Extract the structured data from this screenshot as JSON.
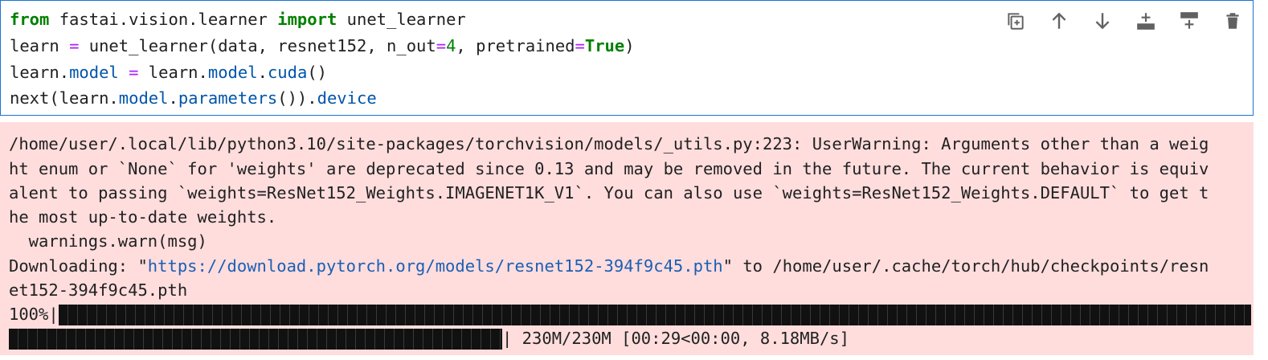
{
  "code": {
    "line1": {
      "kw_from": "from",
      "module": " fastai.vision.learner ",
      "kw_import": "import",
      "name": " unet_learner"
    },
    "line2": {
      "a": "learn ",
      "eq": "=",
      "b": " unet_learner(data, resnet152, n_out",
      "eq2": "=",
      "num": "4",
      "c": ", pretrained",
      "eq3": "=",
      "true": "True",
      "d": ")"
    },
    "line3": {
      "a": "learn.",
      "attr1": "model",
      "b": " ",
      "eq": "=",
      "c": " learn.",
      "attr2": "model",
      "d": ".",
      "attr3": "cuda",
      "e": "()"
    },
    "line4": {
      "a": "next(learn.",
      "attr1": "model",
      "b": ".",
      "attr2": "parameters",
      "c": "()).",
      "attr3": "device"
    }
  },
  "toolbar": {
    "icons": [
      "duplicate-icon",
      "move-up-icon",
      "move-down-icon",
      "insert-below-icon",
      "insert-above-icon",
      "delete-icon"
    ]
  },
  "output": {
    "warn1": "/home/user/.local/lib/python3.10/site-packages/torchvision/models/_utils.py:223: UserWarning: Arguments other than a weig",
    "warn2": "ht enum or `None` for 'weights' are deprecated since 0.13 and may be removed in the future. The current behavior is equiv",
    "warn3": "alent to passing `weights=ResNet152_Weights.IMAGENET1K_V1`. You can also use `weights=ResNet152_Weights.DEFAULT` to get t",
    "warn4": "he most up-to-date weights.",
    "warn5": "  warnings.warn(msg)",
    "dl_prefix": "Downloading: \"",
    "dl_url": "https://download.pytorch.org/models/resnet152-394f9c45.pth",
    "dl_suffix": "\" to /home/user/.cache/torch/hub/checkpoints/resn",
    "dl_cont": "et152-394f9c45.pth",
    "progress_pct": "100%|",
    "progress_pipe": "|",
    "progress_stats": " 230M/230M [00:29<00:00, 8.18MB/s]",
    "progress_fraction": 1.0
  },
  "colors": {
    "keyword": "#008000",
    "operator": "#aa22ff",
    "attribute": "#0055aa",
    "output_bg": "#ffdddd",
    "cell_border": "#1976d2"
  }
}
